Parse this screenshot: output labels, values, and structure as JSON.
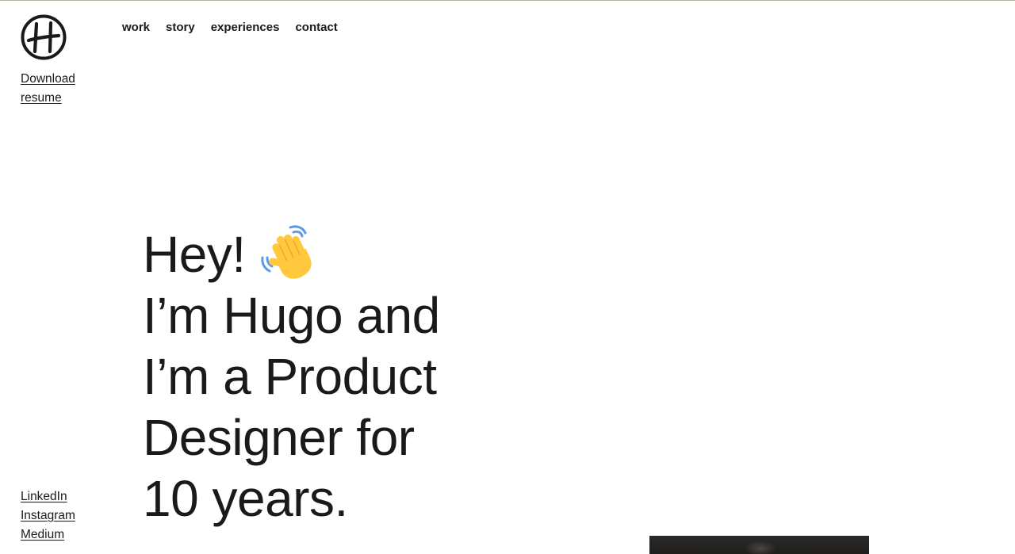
{
  "header": {
    "logo_icon": "hugo-monogram-logo",
    "download_label_line1": "Download",
    "download_label_line2": "resume"
  },
  "nav": {
    "items": [
      {
        "label": "work"
      },
      {
        "label": "story"
      },
      {
        "label": "experiences"
      },
      {
        "label": "contact"
      }
    ]
  },
  "hero": {
    "line1": "Hey!",
    "wave_icon": "waving-hand-icon",
    "line2": "I’m Hugo and",
    "line3": "I’m a Product",
    "line4": "Designer for",
    "line5": "10 years."
  },
  "socials": {
    "items": [
      {
        "label": "LinkedIn"
      },
      {
        "label": "Instagram"
      },
      {
        "label": "Medium"
      }
    ]
  },
  "colors": {
    "text": "#1a1a1a",
    "background": "#ffffff",
    "top_rule": "#b9b2a4",
    "wave_yellow": "#FFC83D",
    "wave_lines": "#5B9BE6"
  }
}
